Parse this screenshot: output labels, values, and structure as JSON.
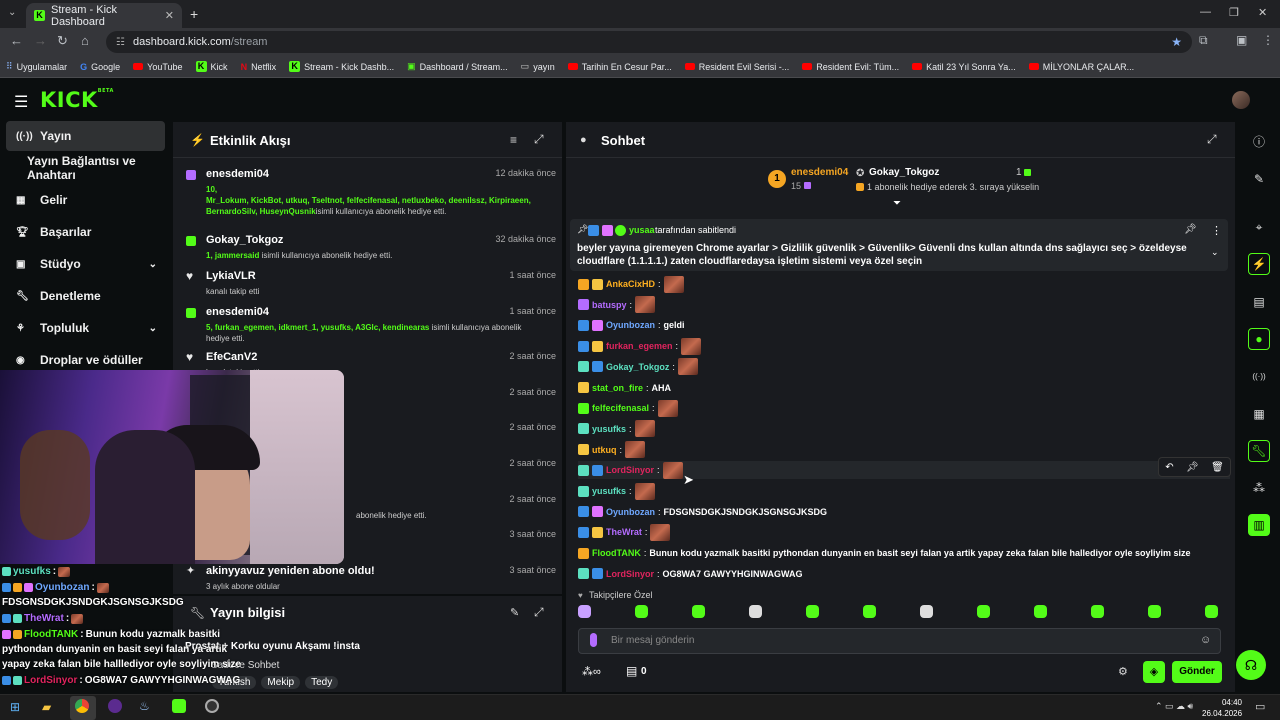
{
  "browser": {
    "tab_title": "Stream - Kick Dashboard",
    "url_domain": "dashboard.kick.com",
    "url_path": "/stream",
    "bookmarks": [
      {
        "label": "Uygulamalar",
        "kind": "apps"
      },
      {
        "label": "Google",
        "kind": "google"
      },
      {
        "label": "YouTube",
        "kind": "yt"
      },
      {
        "label": "Kick",
        "kind": "kick"
      },
      {
        "label": "Netflix",
        "kind": "netflix"
      },
      {
        "label": "Stream - Kick Dashb...",
        "kind": "kick"
      },
      {
        "label": "Dashboard / Stream...",
        "kind": "dash"
      },
      {
        "label": "yayın",
        "kind": "folder"
      },
      {
        "label": "Tarihin En Cesur Par...",
        "kind": "yt"
      },
      {
        "label": "Resident Evil Serisi -...",
        "kind": "yt"
      },
      {
        "label": "Resident Evil: Tüm...",
        "kind": "yt"
      },
      {
        "label": "Katil 23 Yıl Sonra Ya...",
        "kind": "yt"
      },
      {
        "label": "MİLYONLAR ÇALAR...",
        "kind": "yt"
      }
    ]
  },
  "header": {
    "logo": "KICK",
    "logo_beta": "BETA"
  },
  "sidebar": {
    "items": [
      {
        "label": "Yayın",
        "icon": "broadcast-icon"
      },
      {
        "label": "Yayın Bağlantısı ve Anahtarı",
        "icon": ""
      },
      {
        "label": "Gelir",
        "icon": "revenue-icon"
      },
      {
        "label": "Başarılar",
        "icon": "trophy-icon"
      },
      {
        "label": "Stüdyo",
        "icon": "studio-icon"
      },
      {
        "label": "Denetleme",
        "icon": "wrench-icon"
      },
      {
        "label": "Topluluk",
        "icon": "community-icon"
      },
      {
        "label": "Droplar ve ödüller",
        "icon": "drops-icon"
      }
    ]
  },
  "activity": {
    "title": "Etkinlik Akışı",
    "events": [
      {
        "name": "enesdemi04",
        "time": "12 dakika önce",
        "highlight": "10,\nMr_Lokum, KickBot, utkuq, Tseltnot, felfecifenasal, netluxbeko, deenilssz, Kirpiraeen, BernardoSilv, HuseynQusnik",
        "desc": "isimli kullanıcıya abonelik hediye etti.",
        "icon": "gift"
      },
      {
        "name": "Gokay_Tokgoz",
        "time": "32 dakika önce",
        "highlight": "1, jammersaid",
        "desc": " isimli kullanıcıya abonelik hediye etti.",
        "icon": "gift"
      },
      {
        "name": "LykiaVLR",
        "time": "1 saat önce",
        "highlight": "",
        "desc": "kanalı takip etti",
        "icon": "heart"
      },
      {
        "name": "enesdemi04",
        "time": "1 saat önce",
        "highlight": "5, furkan_egemen, idkmert_1, yusufks, A3Glc, kendinearas",
        "desc": " isimli kullanıcıya abonelik hediye etti.",
        "icon": "gift"
      },
      {
        "name": "EfeCanV2",
        "time": "2 saat önce",
        "highlight": "",
        "desc": "kanalı takip etti",
        "icon": "heart"
      },
      {
        "name": "",
        "time": "2 saat önce",
        "highlight": "",
        "desc": "",
        "icon": ""
      },
      {
        "name": "",
        "time": "2 saat önce",
        "highlight": "",
        "desc": "",
        "icon": ""
      },
      {
        "name": "",
        "time": "2 saat önce",
        "highlight": "",
        "desc": "",
        "icon": ""
      },
      {
        "name": "",
        "time": "2 saat önce",
        "highlight": "",
        "desc": "abonelik hediye etti.",
        "icon": ""
      },
      {
        "name": "",
        "time": "3 saat önce",
        "highlight": "",
        "desc": "",
        "icon": ""
      },
      {
        "name": "akinyyavuz yeniden abone oldu!",
        "time": "3 saat önce",
        "highlight": "",
        "desc": "3 aylık abone oldular",
        "icon": "star"
      }
    ]
  },
  "stream_info": {
    "title": "Yayın bilgisi",
    "stream_title": "Prostat + Korku oyunu Akşamı !insta",
    "chat_mode": "Sadece Sohbet",
    "tags": [
      "Turkish",
      "Mekip",
      "Tedy"
    ]
  },
  "chat": {
    "title": "Sohbet",
    "top_gifter": {
      "rank": "1",
      "name": "enesdemi04",
      "count": "15"
    },
    "recent_gifter": {
      "name": "Gokay_Tokgoz",
      "count": "1",
      "note": "1 abonelik hediye ederek 3. sıraya yükselin"
    },
    "pinned": {
      "by": "yusaa",
      "by_suffix": "tarafından sabitlendi",
      "text": "beyler yayına giremeyen Chrome ayarlar > Gizlilik güvenlik > Güvenlik> Güvenli dns kullan altında dns sağlayıcı seç > özeldeyse cloudflare (1.1.1.1.) zaten cloudflaredaysa işletim sistemi veya özel seçin"
    },
    "messages": [
      {
        "user": "AnkaCixHD",
        "color": "#ffb020",
        "text": "",
        "emote": true
      },
      {
        "user": "batuspy",
        "color": "#b46cff",
        "text": "",
        "emote": true
      },
      {
        "user": "Oyunbozan",
        "color": "#6fa8ff",
        "text": "geldi",
        "emote": false
      },
      {
        "user": "furkan_egemen",
        "color": "#e0245e",
        "text": "",
        "emote": true
      },
      {
        "user": "Gokay_Tokgoz",
        "color": "#5ce0c0",
        "text": "",
        "emote": true
      },
      {
        "user": "stat_on_fire",
        "color": "#53fc18",
        "text": "AHA",
        "emote": false
      },
      {
        "user": "felfecifenasal",
        "color": "#53fc18",
        "text": "",
        "emote": true
      },
      {
        "user": "yusufks",
        "color": "#5ce0c0",
        "text": "",
        "emote": true
      },
      {
        "user": "utkuq",
        "color": "#ffb020",
        "text": "",
        "emote": true
      },
      {
        "user": "LordSinyor",
        "color": "#e0245e",
        "text": "",
        "emote": true
      },
      {
        "user": "yusufks",
        "color": "#5ce0c0",
        "text": "",
        "emote": true
      },
      {
        "user": "Oyunbozan",
        "color": "#6fa8ff",
        "text": "FDSGNSDGKJSNDGKJSGNSGJKSDG",
        "emote": false
      },
      {
        "user": "TheWrat",
        "color": "#b46cff",
        "text": "",
        "emote": true
      },
      {
        "user": "FloodTANK",
        "color": "#53fc18",
        "text": "Bunun kodu yazmalk basitki pythondan dunyanin en basit seyi falan ya artik yapay zeka falan bile hallediyor oyle soyliyim size",
        "emote": false
      },
      {
        "user": "LordSinyor",
        "color": "#e0245e",
        "text": "OG8WA7 GAWYYHGINWAGWAG",
        "emote": false
      }
    ],
    "followers_label": "Takipçilere Özel",
    "input_placeholder": "Bir mesaj gönderin",
    "points_value": "0",
    "send_label": "Gönder"
  },
  "overlay_chat": [
    {
      "user": "yusufks",
      "color": "#5ce0c0",
      "text": ""
    },
    {
      "user": "Oyunbozan",
      "color": "#6fa8ff",
      "text": ""
    },
    {
      "user": "",
      "color": "#ffffff",
      "text": "FDSGNSDGKJSNDGKJSGNSGJKSDG"
    },
    {
      "user": "TheWrat",
      "color": "#b46cff",
      "text": ""
    },
    {
      "user": "FloodTANK",
      "color": "#53fc18",
      "text": "Bunun kodu yazmalk basitki"
    },
    {
      "user": "",
      "color": "#ffffff",
      "text": "pythondan dunyanin en basit seyi falan ya artik"
    },
    {
      "user": "",
      "color": "#ffffff",
      "text": "yapay zeka falan bile halllediyor oyle soyliyim size"
    },
    {
      "user": "LordSinyor",
      "color": "#e0245e",
      "text": "OG8WA7 GAWYYHGINWAGWAG"
    }
  ],
  "taskbar": {
    "time": "04:40",
    "date": "26.04.2026"
  },
  "colors": {
    "accent": "#53fc18",
    "panel": "#191b1f",
    "bg": "#0b0e0f"
  }
}
